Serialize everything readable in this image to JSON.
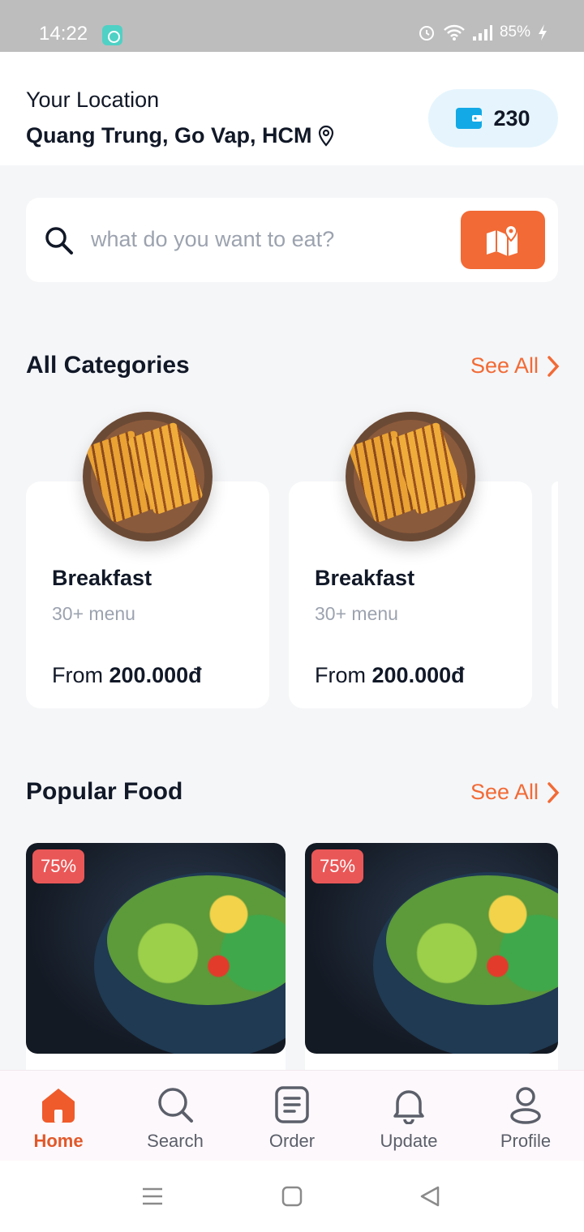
{
  "status_bar": {
    "time": "14:22",
    "battery": "85%"
  },
  "header": {
    "location_label": "Your Location",
    "location_value": "Quang Trung, Go Vap, HCM",
    "wallet_value": "230"
  },
  "search": {
    "placeholder": "what do you want to eat?"
  },
  "categories": {
    "title": "All Categories",
    "see_all": "See All",
    "items": [
      {
        "name": "Breakfast",
        "menu": "30+ menu",
        "price_prefix": "From",
        "price": "200.000đ"
      },
      {
        "name": "Breakfast",
        "menu": "30+ menu",
        "price_prefix": "From",
        "price": "200.000đ"
      }
    ]
  },
  "popular": {
    "title": "Popular Food",
    "see_all": "See All",
    "items": [
      {
        "discount": "75%"
      },
      {
        "discount": "75%"
      }
    ]
  },
  "nav": {
    "items": [
      {
        "label": "Home",
        "icon": "home-icon",
        "active": true
      },
      {
        "label": "Search",
        "icon": "search-icon",
        "active": false
      },
      {
        "label": "Order",
        "icon": "order-icon",
        "active": false
      },
      {
        "label": "Update",
        "icon": "bell-icon",
        "active": false
      },
      {
        "label": "Profile",
        "icon": "profile-icon",
        "active": false
      }
    ]
  },
  "colors": {
    "accent": "#f26a35",
    "badge": "#ea5757",
    "wallet_bg": "#e6f5fd"
  }
}
